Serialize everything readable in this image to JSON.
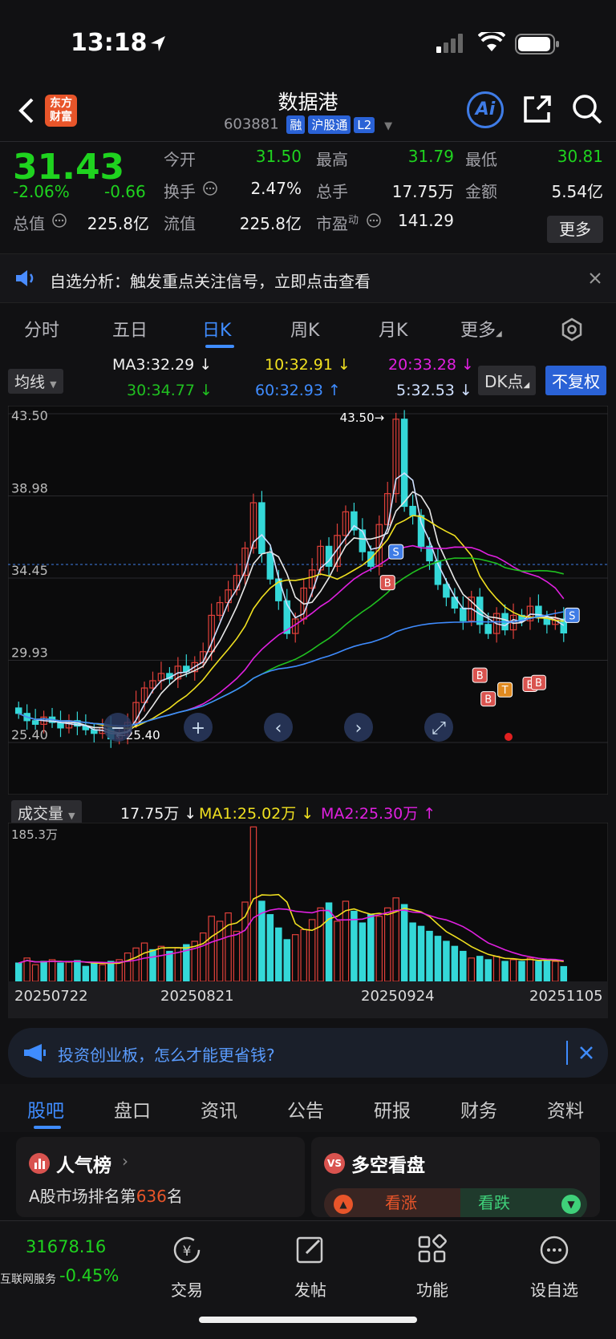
{
  "status_bar": {
    "time": "13:18"
  },
  "header": {
    "title": "数据港",
    "code": "603881",
    "tags": [
      "融",
      "沪股通",
      "L2"
    ],
    "logo_text": "东方财富",
    "ai_label": "Ai"
  },
  "quote": {
    "price": "31.43",
    "change_pct": "-2.06%",
    "change": "-0.66",
    "fields": [
      {
        "label": "今开",
        "value": "31.50",
        "color": "#1fd31f"
      },
      {
        "label": "最高",
        "value": "31.79",
        "color": "#1fd31f"
      },
      {
        "label": "最低",
        "value": "30.81",
        "color": "#1fd31f"
      },
      {
        "label": "换手",
        "value": "2.47%",
        "color": "#f2f2f2"
      },
      {
        "label": "总手",
        "value": "17.75万",
        "color": "#f2f2f2"
      },
      {
        "label": "金额",
        "value": "5.54亿",
        "color": "#f2f2f2"
      },
      {
        "label": "总值",
        "value": "225.8亿",
        "color": "#f2f2f2"
      },
      {
        "label": "流值",
        "value": "225.8亿",
        "color": "#f2f2f2"
      },
      {
        "label": "市盈",
        "value": "141.29",
        "color": "#f2f2f2"
      }
    ],
    "pe_superscript": "动",
    "more_label": "更多"
  },
  "notice": {
    "text": "自选分析：触发重点关注信号，立即点击查看"
  },
  "ktabs": [
    "分时",
    "五日",
    "日K",
    "周K",
    "月K",
    "更多"
  ],
  "ktabs_active": 2,
  "ma_legend": {
    "dropdown": "均线",
    "items": [
      {
        "text": "MA3:32.29 ↓",
        "color": "#f2f2f2"
      },
      {
        "text": "10:32.91 ↓",
        "color": "#f0e020"
      },
      {
        "text": "20:33.28 ↓",
        "color": "#e020e0"
      },
      {
        "text": "30:34.77 ↓",
        "color": "#20c020"
      },
      {
        "text": "60:32.93 ↑",
        "color": "#3f8cff"
      },
      {
        "text": "5:32.53 ↓",
        "color": "#cfe0ff"
      }
    ],
    "dk_label": "DK点",
    "fq_label": "不复权"
  },
  "chart_data": {
    "type": "candlestick",
    "y_ticks": [
      "43.50",
      "38.98",
      "34.45",
      "29.93",
      "25.40"
    ],
    "ylim": [
      25.4,
      43.5
    ],
    "high_label": "43.50→",
    "low_label": "←25.40",
    "x_ticks": [
      "20250722",
      "20250821",
      "20250924",
      "20251105"
    ],
    "last_close": 31.43,
    "closes": [
      27.0,
      26.6,
      26.4,
      26.8,
      26.5,
      26.2,
      26.6,
      26.3,
      26.1,
      25.9,
      26.2,
      25.6,
      25.8,
      26.5,
      27.6,
      28.4,
      28.8,
      29.2,
      28.9,
      29.6,
      29.3,
      29.8,
      30.4,
      32.4,
      33.1,
      33.8,
      34.6,
      36.1,
      38.6,
      35.8,
      34.4,
      33.2,
      31.4,
      32.2,
      33.9,
      34.9,
      36.2,
      35.1,
      36.8,
      38.1,
      37.1,
      35.9,
      35.1,
      37.4,
      39.1,
      43.2,
      38.4,
      37.9,
      36.2,
      35.4,
      34.1,
      33.4,
      32.8,
      32.1,
      33.4,
      31.9,
      31.4,
      32.5,
      31.6,
      32.4,
      32.1,
      32.9,
      32.3,
      31.9,
      32.2,
      31.43
    ],
    "volume": {
      "label": "成交量",
      "current": "17.75万 ↓",
      "ma1": "MA1:25.02万 ↓",
      "ma2": "MA2:25.30万 ↑",
      "max_label": "185.3万",
      "max": 185.3,
      "values": [
        22,
        28,
        20,
        24,
        26,
        22,
        24,
        25,
        18,
        21,
        20,
        24,
        26,
        34,
        40,
        46,
        38,
        42,
        36,
        40,
        44,
        48,
        58,
        78,
        72,
        82,
        60,
        95,
        185,
        96,
        80,
        64,
        50,
        56,
        62,
        74,
        88,
        94,
        72,
        96,
        84,
        70,
        80,
        78,
        88,
        100,
        92,
        70,
        66,
        60,
        54,
        48,
        42,
        36,
        28,
        30,
        26,
        30,
        24,
        26,
        24,
        28,
        24,
        26,
        24,
        17.75
      ],
      "up": [
        false,
        true,
        true,
        false,
        true,
        false,
        true,
        false,
        false,
        false,
        true,
        false,
        true,
        true,
        true,
        true,
        false,
        true,
        false,
        true,
        false,
        true,
        true,
        true,
        true,
        true,
        true,
        true,
        true,
        false,
        false,
        false,
        false,
        true,
        true,
        true,
        true,
        false,
        true,
        true,
        false,
        false,
        false,
        true,
        true,
        true,
        false,
        false,
        false,
        false,
        false,
        false,
        false,
        false,
        true,
        false,
        false,
        true,
        false,
        true,
        false,
        true,
        false,
        false,
        true,
        false
      ]
    }
  },
  "ad": {
    "text": "投资创业板，怎么才能更省钱?"
  },
  "section_tabs": [
    "股吧",
    "盘口",
    "资讯",
    "公告",
    "研报",
    "财务",
    "资料"
  ],
  "cards": {
    "left": {
      "title": "人气榜",
      "line1_pre": "A股市场排名第",
      "line1_num": "636",
      "line1_post": "名"
    },
    "right": {
      "title": "多空看盘",
      "bull": "看涨",
      "bear": "看跌"
    }
  },
  "bottom_bar": {
    "index_value": "31678.16",
    "index_name": "互联网服务",
    "index_change": "-0.45%",
    "items": [
      "交易",
      "发帖",
      "功能",
      "设自选"
    ]
  }
}
